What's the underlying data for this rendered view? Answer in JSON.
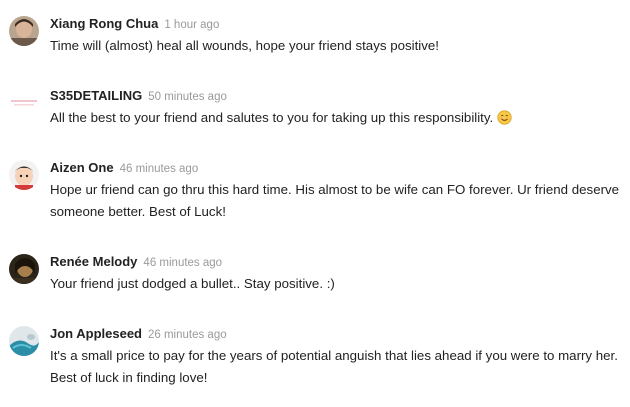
{
  "comments": [
    {
      "author": "Xiang Rong Chua",
      "time": "1 hour ago",
      "text": "Time will (almost) heal all wounds, hope your friend stays positive!"
    },
    {
      "author": "S35DETAILING",
      "time": "50 minutes ago",
      "text": "All the best to your friend and salutes to you for taking up this responsibility.",
      "emoji": "smiling-face"
    },
    {
      "author": "Aizen One",
      "time": "46 minutes ago",
      "text": "Hope ur friend can go thru this hard time. His almost to be wife can FO forever. Ur friend deserve someone better. Best of Luck!"
    },
    {
      "author": "Renée Melody",
      "time": "46 minutes ago",
      "text": "Your friend just dodged a bullet.. Stay positive. :)"
    },
    {
      "author": "Jon Appleseed",
      "time": "26 minutes ago",
      "text": "It's a small price to pay for the years of potential anguish that lies ahead if you were to marry her. Best of luck in finding love!"
    }
  ],
  "colors": {
    "author": "#222222",
    "timestamp": "#9a9a9a",
    "text": "#222222",
    "emoji": "#f5c542"
  }
}
